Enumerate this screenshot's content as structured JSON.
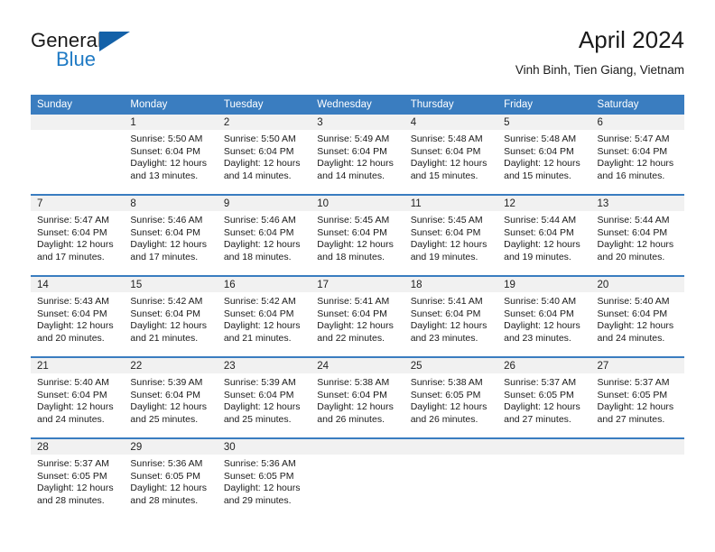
{
  "brand": {
    "name_top": "General",
    "name_bottom": "Blue",
    "flag_icon": "triangle-flag-icon",
    "accent_color": "#1f7ac4",
    "flag_color": "#1461a8"
  },
  "header": {
    "title": "April 2024",
    "location": "Vinh Binh, Tien Giang, Vietnam"
  },
  "calendar": {
    "header_color": "#3a7dc0",
    "daynum_band_color": "#f1f1f1",
    "weekday_headers": [
      "Sunday",
      "Monday",
      "Tuesday",
      "Wednesday",
      "Thursday",
      "Friday",
      "Saturday"
    ],
    "weeks": [
      [
        {
          "day": "",
          "empty": true,
          "sunrise": "",
          "sunset": "",
          "daylight_1": "",
          "daylight_2": ""
        },
        {
          "day": "1",
          "empty": false,
          "sunrise": "Sunrise: 5:50 AM",
          "sunset": "Sunset: 6:04 PM",
          "daylight_1": "Daylight: 12 hours",
          "daylight_2": "and 13 minutes."
        },
        {
          "day": "2",
          "empty": false,
          "sunrise": "Sunrise: 5:50 AM",
          "sunset": "Sunset: 6:04 PM",
          "daylight_1": "Daylight: 12 hours",
          "daylight_2": "and 14 minutes."
        },
        {
          "day": "3",
          "empty": false,
          "sunrise": "Sunrise: 5:49 AM",
          "sunset": "Sunset: 6:04 PM",
          "daylight_1": "Daylight: 12 hours",
          "daylight_2": "and 14 minutes."
        },
        {
          "day": "4",
          "empty": false,
          "sunrise": "Sunrise: 5:48 AM",
          "sunset": "Sunset: 6:04 PM",
          "daylight_1": "Daylight: 12 hours",
          "daylight_2": "and 15 minutes."
        },
        {
          "day": "5",
          "empty": false,
          "sunrise": "Sunrise: 5:48 AM",
          "sunset": "Sunset: 6:04 PM",
          "daylight_1": "Daylight: 12 hours",
          "daylight_2": "and 15 minutes."
        },
        {
          "day": "6",
          "empty": false,
          "sunrise": "Sunrise: 5:47 AM",
          "sunset": "Sunset: 6:04 PM",
          "daylight_1": "Daylight: 12 hours",
          "daylight_2": "and 16 minutes."
        }
      ],
      [
        {
          "day": "7",
          "empty": false,
          "sunrise": "Sunrise: 5:47 AM",
          "sunset": "Sunset: 6:04 PM",
          "daylight_1": "Daylight: 12 hours",
          "daylight_2": "and 17 minutes."
        },
        {
          "day": "8",
          "empty": false,
          "sunrise": "Sunrise: 5:46 AM",
          "sunset": "Sunset: 6:04 PM",
          "daylight_1": "Daylight: 12 hours",
          "daylight_2": "and 17 minutes."
        },
        {
          "day": "9",
          "empty": false,
          "sunrise": "Sunrise: 5:46 AM",
          "sunset": "Sunset: 6:04 PM",
          "daylight_1": "Daylight: 12 hours",
          "daylight_2": "and 18 minutes."
        },
        {
          "day": "10",
          "empty": false,
          "sunrise": "Sunrise: 5:45 AM",
          "sunset": "Sunset: 6:04 PM",
          "daylight_1": "Daylight: 12 hours",
          "daylight_2": "and 18 minutes."
        },
        {
          "day": "11",
          "empty": false,
          "sunrise": "Sunrise: 5:45 AM",
          "sunset": "Sunset: 6:04 PM",
          "daylight_1": "Daylight: 12 hours",
          "daylight_2": "and 19 minutes."
        },
        {
          "day": "12",
          "empty": false,
          "sunrise": "Sunrise: 5:44 AM",
          "sunset": "Sunset: 6:04 PM",
          "daylight_1": "Daylight: 12 hours",
          "daylight_2": "and 19 minutes."
        },
        {
          "day": "13",
          "empty": false,
          "sunrise": "Sunrise: 5:44 AM",
          "sunset": "Sunset: 6:04 PM",
          "daylight_1": "Daylight: 12 hours",
          "daylight_2": "and 20 minutes."
        }
      ],
      [
        {
          "day": "14",
          "empty": false,
          "sunrise": "Sunrise: 5:43 AM",
          "sunset": "Sunset: 6:04 PM",
          "daylight_1": "Daylight: 12 hours",
          "daylight_2": "and 20 minutes."
        },
        {
          "day": "15",
          "empty": false,
          "sunrise": "Sunrise: 5:42 AM",
          "sunset": "Sunset: 6:04 PM",
          "daylight_1": "Daylight: 12 hours",
          "daylight_2": "and 21 minutes."
        },
        {
          "day": "16",
          "empty": false,
          "sunrise": "Sunrise: 5:42 AM",
          "sunset": "Sunset: 6:04 PM",
          "daylight_1": "Daylight: 12 hours",
          "daylight_2": "and 21 minutes."
        },
        {
          "day": "17",
          "empty": false,
          "sunrise": "Sunrise: 5:41 AM",
          "sunset": "Sunset: 6:04 PM",
          "daylight_1": "Daylight: 12 hours",
          "daylight_2": "and 22 minutes."
        },
        {
          "day": "18",
          "empty": false,
          "sunrise": "Sunrise: 5:41 AM",
          "sunset": "Sunset: 6:04 PM",
          "daylight_1": "Daylight: 12 hours",
          "daylight_2": "and 23 minutes."
        },
        {
          "day": "19",
          "empty": false,
          "sunrise": "Sunrise: 5:40 AM",
          "sunset": "Sunset: 6:04 PM",
          "daylight_1": "Daylight: 12 hours",
          "daylight_2": "and 23 minutes."
        },
        {
          "day": "20",
          "empty": false,
          "sunrise": "Sunrise: 5:40 AM",
          "sunset": "Sunset: 6:04 PM",
          "daylight_1": "Daylight: 12 hours",
          "daylight_2": "and 24 minutes."
        }
      ],
      [
        {
          "day": "21",
          "empty": false,
          "sunrise": "Sunrise: 5:40 AM",
          "sunset": "Sunset: 6:04 PM",
          "daylight_1": "Daylight: 12 hours",
          "daylight_2": "and 24 minutes."
        },
        {
          "day": "22",
          "empty": false,
          "sunrise": "Sunrise: 5:39 AM",
          "sunset": "Sunset: 6:04 PM",
          "daylight_1": "Daylight: 12 hours",
          "daylight_2": "and 25 minutes."
        },
        {
          "day": "23",
          "empty": false,
          "sunrise": "Sunrise: 5:39 AM",
          "sunset": "Sunset: 6:04 PM",
          "daylight_1": "Daylight: 12 hours",
          "daylight_2": "and 25 minutes."
        },
        {
          "day": "24",
          "empty": false,
          "sunrise": "Sunrise: 5:38 AM",
          "sunset": "Sunset: 6:04 PM",
          "daylight_1": "Daylight: 12 hours",
          "daylight_2": "and 26 minutes."
        },
        {
          "day": "25",
          "empty": false,
          "sunrise": "Sunrise: 5:38 AM",
          "sunset": "Sunset: 6:05 PM",
          "daylight_1": "Daylight: 12 hours",
          "daylight_2": "and 26 minutes."
        },
        {
          "day": "26",
          "empty": false,
          "sunrise": "Sunrise: 5:37 AM",
          "sunset": "Sunset: 6:05 PM",
          "daylight_1": "Daylight: 12 hours",
          "daylight_2": "and 27 minutes."
        },
        {
          "day": "27",
          "empty": false,
          "sunrise": "Sunrise: 5:37 AM",
          "sunset": "Sunset: 6:05 PM",
          "daylight_1": "Daylight: 12 hours",
          "daylight_2": "and 27 minutes."
        }
      ],
      [
        {
          "day": "28",
          "empty": false,
          "sunrise": "Sunrise: 5:37 AM",
          "sunset": "Sunset: 6:05 PM",
          "daylight_1": "Daylight: 12 hours",
          "daylight_2": "and 28 minutes."
        },
        {
          "day": "29",
          "empty": false,
          "sunrise": "Sunrise: 5:36 AM",
          "sunset": "Sunset: 6:05 PM",
          "daylight_1": "Daylight: 12 hours",
          "daylight_2": "and 28 minutes."
        },
        {
          "day": "30",
          "empty": false,
          "sunrise": "Sunrise: 5:36 AM",
          "sunset": "Sunset: 6:05 PM",
          "daylight_1": "Daylight: 12 hours",
          "daylight_2": "and 29 minutes."
        },
        {
          "day": "",
          "empty": true,
          "sunrise": "",
          "sunset": "",
          "daylight_1": "",
          "daylight_2": ""
        },
        {
          "day": "",
          "empty": true,
          "sunrise": "",
          "sunset": "",
          "daylight_1": "",
          "daylight_2": ""
        },
        {
          "day": "",
          "empty": true,
          "sunrise": "",
          "sunset": "",
          "daylight_1": "",
          "daylight_2": ""
        },
        {
          "day": "",
          "empty": true,
          "sunrise": "",
          "sunset": "",
          "daylight_1": "",
          "daylight_2": ""
        }
      ]
    ]
  }
}
